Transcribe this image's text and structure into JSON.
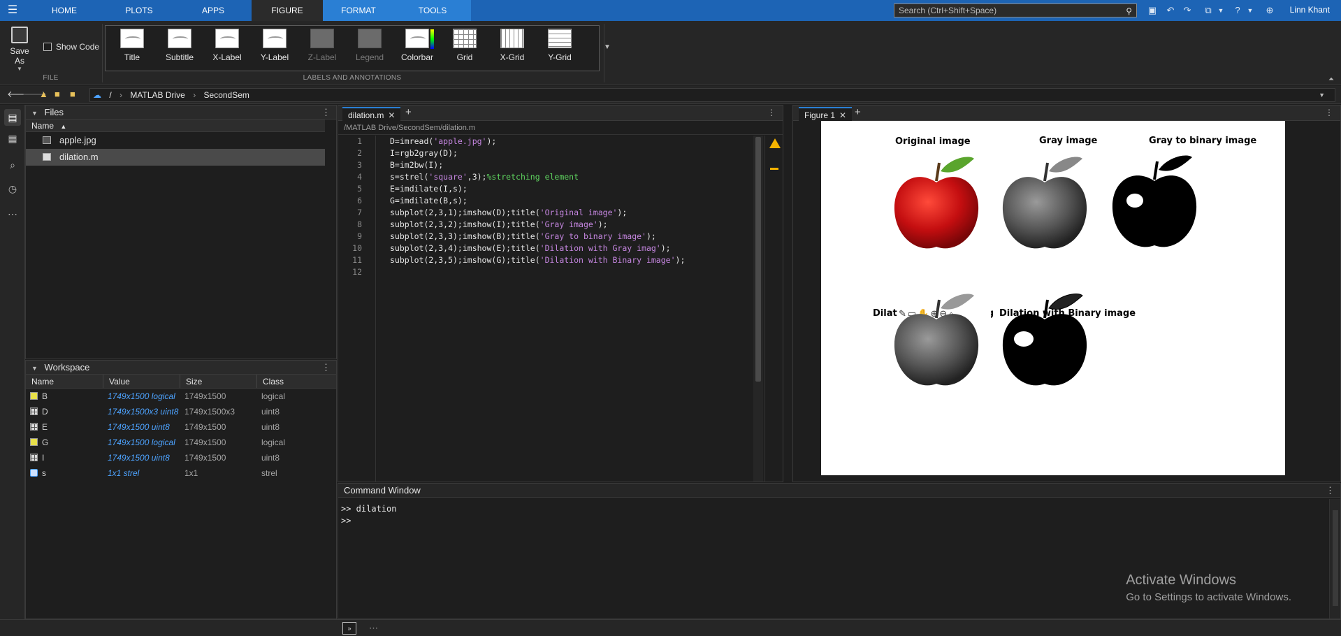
{
  "ribbon": {
    "tabs": [
      {
        "label": "HOME"
      },
      {
        "label": "PLOTS"
      },
      {
        "label": "APPS"
      },
      {
        "label": "FIGURE"
      },
      {
        "label": "FORMAT"
      },
      {
        "label": "TOOLS"
      }
    ],
    "search_placeholder": "Search (Ctrl+Shift+Space)",
    "user_name": "Linn Khant"
  },
  "toolstrip": {
    "save_as_label": "Save As",
    "show_code_label": "Show Code",
    "file_section_label": "FILE",
    "labels_section_label": "LABELS AND ANNOTATIONS",
    "gallery": [
      {
        "label": "Title",
        "icon": "title-icon"
      },
      {
        "label": "Subtitle",
        "icon": "subtitle-icon"
      },
      {
        "label": "X-Label",
        "icon": "xlabel-icon"
      },
      {
        "label": "Y-Label",
        "icon": "ylabel-icon"
      },
      {
        "label": "Z-Label",
        "icon": "zlabel-icon"
      },
      {
        "label": "Legend",
        "icon": "legend-icon"
      },
      {
        "label": "Colorbar",
        "icon": "colorbar-icon"
      },
      {
        "label": "Grid",
        "icon": "grid-icon"
      },
      {
        "label": "X-Grid",
        "icon": "xgrid-icon"
      },
      {
        "label": "Y-Grid",
        "icon": "ygrid-icon"
      }
    ]
  },
  "address": {
    "crumbs": [
      "/",
      "MATLAB Drive",
      "SecondSem"
    ]
  },
  "files_panel": {
    "title": "Files",
    "column_name": "Name",
    "sort_indicator": "▲",
    "files": [
      {
        "name": "apple.jpg"
      },
      {
        "name": "dilation.m"
      }
    ]
  },
  "workspace": {
    "title": "Workspace",
    "columns": [
      "Name",
      "Value",
      "Size",
      "Class"
    ],
    "rows": [
      {
        "name": "B",
        "value": "1749x1500 logical",
        "size": "1749x1500",
        "class": "logical",
        "kind": "logical"
      },
      {
        "name": "D",
        "value": "1749x1500x3 uint8",
        "size": "1749x1500x3",
        "class": "uint8",
        "kind": "matrix"
      },
      {
        "name": "E",
        "value": "1749x1500 uint8",
        "size": "1749x1500",
        "class": "uint8",
        "kind": "matrix"
      },
      {
        "name": "G",
        "value": "1749x1500 logical",
        "size": "1749x1500",
        "class": "logical",
        "kind": "logical"
      },
      {
        "name": "I",
        "value": "1749x1500 uint8",
        "size": "1749x1500",
        "class": "uint8",
        "kind": "matrix"
      },
      {
        "name": "s",
        "value": "1x1 strel",
        "size": "1x1",
        "class": "strel",
        "kind": "obj"
      }
    ]
  },
  "editor": {
    "tab_label": "dilation.m",
    "file_path": "/MATLAB Drive/SecondSem/dilation.m",
    "lines": [
      [
        {
          "t": "D=imread("
        },
        {
          "t": "'apple.jpg'",
          "c": "str"
        },
        {
          "t": ");"
        }
      ],
      [
        {
          "t": "I=rgb2gray(D);"
        }
      ],
      [
        {
          "t": "B=im2bw(I);"
        }
      ],
      [
        {
          "t": "s=strel("
        },
        {
          "t": "'square'",
          "c": "str"
        },
        {
          "t": ",3);"
        },
        {
          "t": "%stretching element",
          "c": "cmt"
        }
      ],
      [
        {
          "t": "E=imdilate(I,s);"
        }
      ],
      [
        {
          "t": "G=imdilate(B,s);"
        }
      ],
      [
        {
          "t": "subplot(2,3,1);imshow(D);title("
        },
        {
          "t": "'Original image'",
          "c": "str"
        },
        {
          "t": ");"
        }
      ],
      [
        {
          "t": "subplot(2,3,2);imshow(I);title("
        },
        {
          "t": "'Gray image'",
          "c": "str"
        },
        {
          "t": ");"
        }
      ],
      [
        {
          "t": "subplot(2,3,3);imshow(B);title("
        },
        {
          "t": "'Gray to binary image'",
          "c": "str"
        },
        {
          "t": ");"
        }
      ],
      [
        {
          "t": "subplot(2,3,4);imshow(E);title("
        },
        {
          "t": "'Dilation with Gray imag'",
          "c": "str"
        },
        {
          "t": ");"
        }
      ],
      [
        {
          "t": "subplot(2,3,5);imshow(G);title("
        },
        {
          "t": "'Dilation with Binary image'",
          "c": "str"
        },
        {
          "t": ");"
        }
      ],
      []
    ]
  },
  "figure": {
    "tab_label": "Figure 1",
    "subplots": [
      {
        "title": "Original image",
        "style": "red"
      },
      {
        "title": "Gray image",
        "style": "gray"
      },
      {
        "title": "Gray to binary image",
        "style": "binary"
      },
      {
        "title_start": "Dilat",
        "title_end": "ag",
        "style": "gray"
      },
      {
        "title": "Dilation with Binary image",
        "style": "binary"
      }
    ]
  },
  "command_window": {
    "title": "Command Window",
    "lines": [
      ">> dilation",
      ">>"
    ]
  },
  "watermark": {
    "title": "Activate Windows",
    "subtitle": "Go to Settings to activate Windows."
  }
}
